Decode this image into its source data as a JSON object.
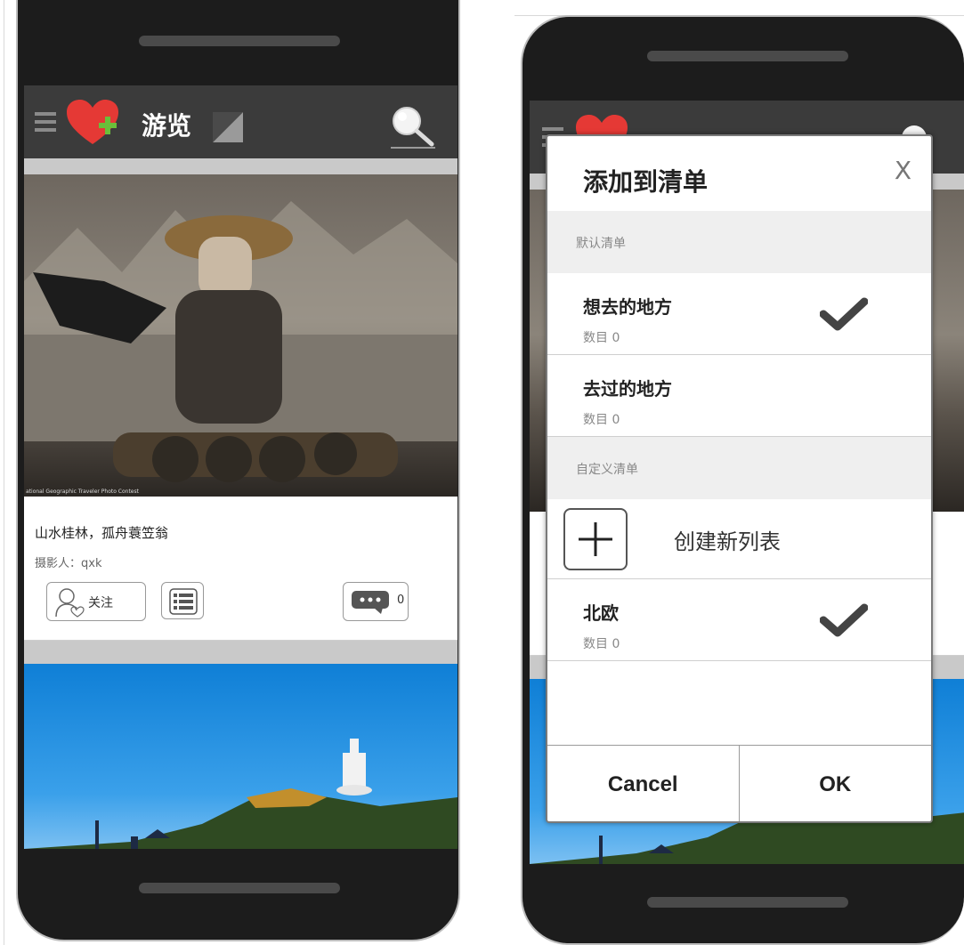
{
  "app": {
    "title": "游览"
  },
  "feed": {
    "photo_credit": "ational Geographic Traveler Photo Contest",
    "card_title": "山水桂林，孤舟蓑笠翁",
    "author": "摄影人：qxk",
    "follow_label": "关注",
    "comment_count": "0"
  },
  "dialog": {
    "title": "添加到清单",
    "close": "X",
    "default_section": "默认清单",
    "default_lists": [
      {
        "name": "想去的地方",
        "count": "数目 0",
        "checked": true
      },
      {
        "name": "去过的地方",
        "count": "数目 0",
        "checked": false
      }
    ],
    "custom_section": "自定义清单",
    "create_label": "创建新列表",
    "custom_lists": [
      {
        "name": "北欧",
        "count": "数目 0",
        "checked": true
      }
    ],
    "cancel": "Cancel",
    "ok": "OK"
  },
  "colors": {
    "header_bg": "#3b3b3b",
    "logo_heart": "#e53935",
    "logo_plus": "#6abf3a",
    "sky_blue": "#1f8fdc"
  }
}
